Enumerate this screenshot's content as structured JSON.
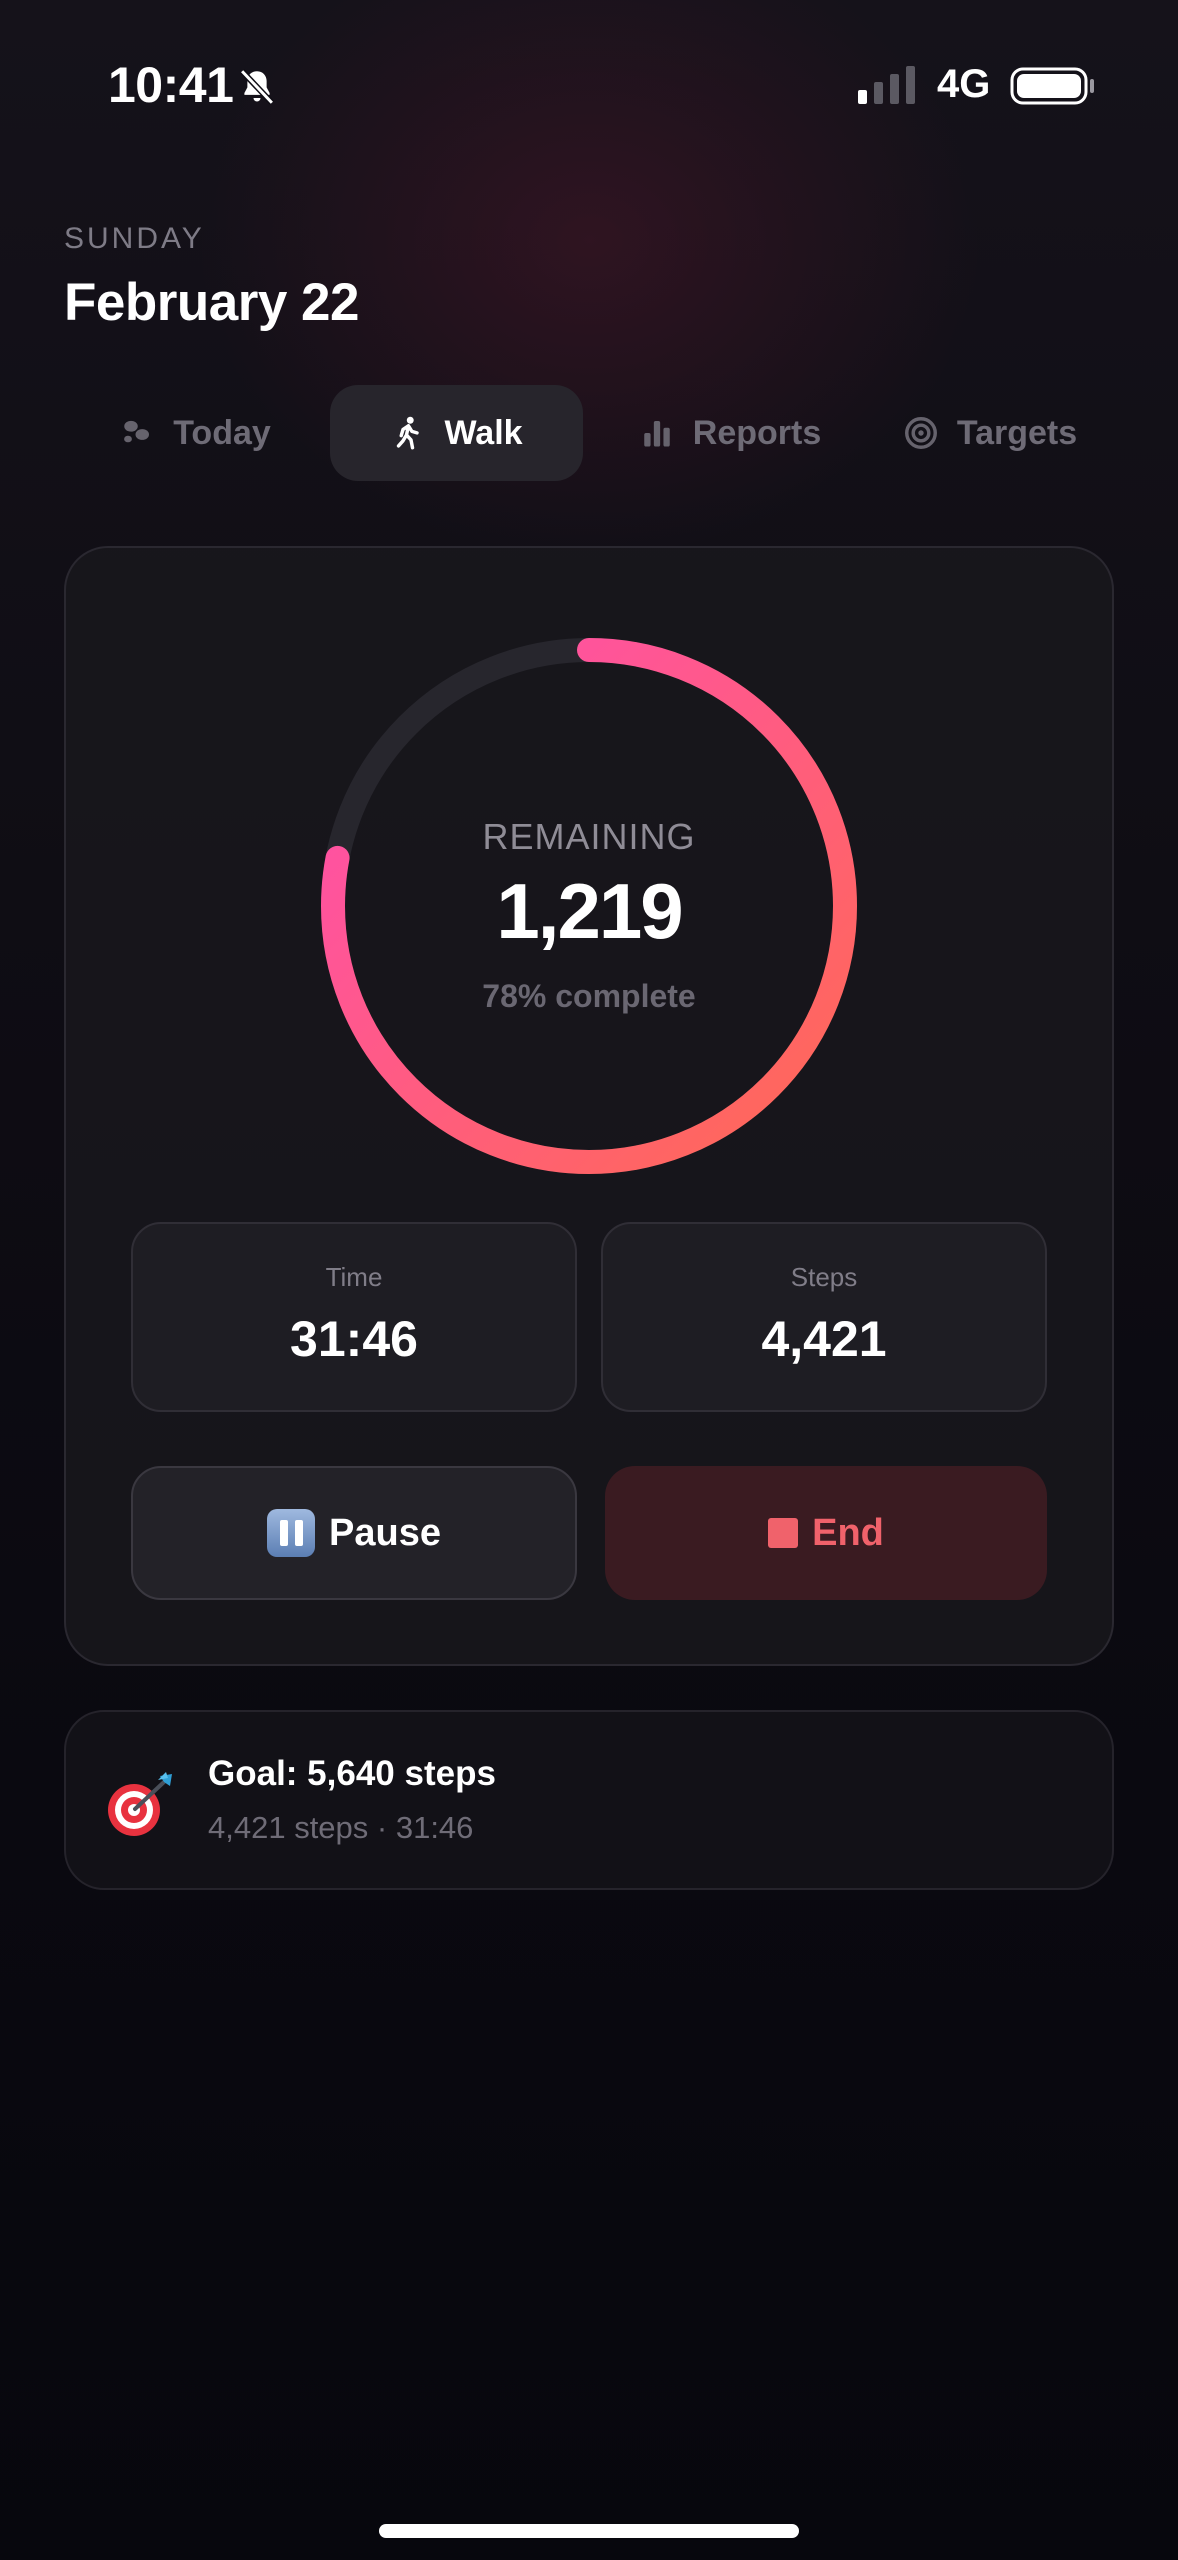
{
  "status_bar": {
    "time": "10:41",
    "network": "4G",
    "icons": [
      "bell-slash-icon",
      "signal-icon",
      "battery-icon"
    ]
  },
  "header": {
    "day": "SUNDAY",
    "date": "February 22"
  },
  "tabs": [
    {
      "label": "Today",
      "icon": "footprints-icon",
      "active": false
    },
    {
      "label": "Walk",
      "icon": "walking-person-icon",
      "active": true
    },
    {
      "label": "Reports",
      "icon": "bar-chart-icon",
      "active": false
    },
    {
      "label": "Targets",
      "icon": "target-icon",
      "active": false
    }
  ],
  "progress": {
    "label": "REMAINING",
    "remaining": "1,219",
    "percent_text": "78% complete",
    "fraction": 0.78,
    "colors": {
      "start": "#ff6a52",
      "end": "#ff4db2",
      "track": "#27262d"
    }
  },
  "stats": {
    "time": {
      "label": "Time",
      "value": "31:46"
    },
    "steps": {
      "label": "Steps",
      "value": "4,421"
    }
  },
  "actions": {
    "pause_label": "Pause",
    "end_label": "End",
    "pause_icon": "pause-button-icon",
    "end_icon": "stop-square-icon"
  },
  "goal": {
    "icon": "dart-target-icon",
    "title": "Goal: 5,640 steps",
    "subtitle": "4,421 steps · 31:46"
  },
  "colors": {
    "accent_pink": "#ff4db2",
    "accent_coral": "#ff6a52",
    "end_red": "#f0626b"
  }
}
